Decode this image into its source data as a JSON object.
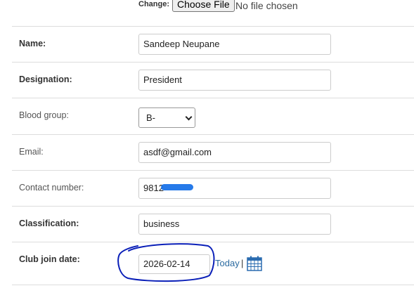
{
  "change_row": {
    "label": "Change:",
    "button_label": "Choose File",
    "status": "No file chosen"
  },
  "fields": {
    "name": {
      "label": "Name:",
      "value": "Sandeep Neupane"
    },
    "designation": {
      "label": "Designation:",
      "value": "President"
    },
    "blood_group": {
      "label": "Blood group:",
      "value": "B-"
    },
    "email": {
      "label": "Email:",
      "value": "asdf@gmail.com"
    },
    "contact": {
      "label": "Contact number:",
      "value": "9812"
    },
    "classification": {
      "label": "Classification:",
      "value": "business"
    },
    "club_join_date": {
      "label": "Club join date:",
      "value": "2026-02-14",
      "today_label": "Today",
      "separator": "|"
    }
  },
  "colors": {
    "link": "#2a6aa0",
    "annotation": "#0a1fb8",
    "redaction": "#1a73e8",
    "calendar_icon": "#2b6cb0"
  },
  "icons": {
    "calendar": "calendar-icon",
    "select_arrow": "chevron-down-icon"
  }
}
